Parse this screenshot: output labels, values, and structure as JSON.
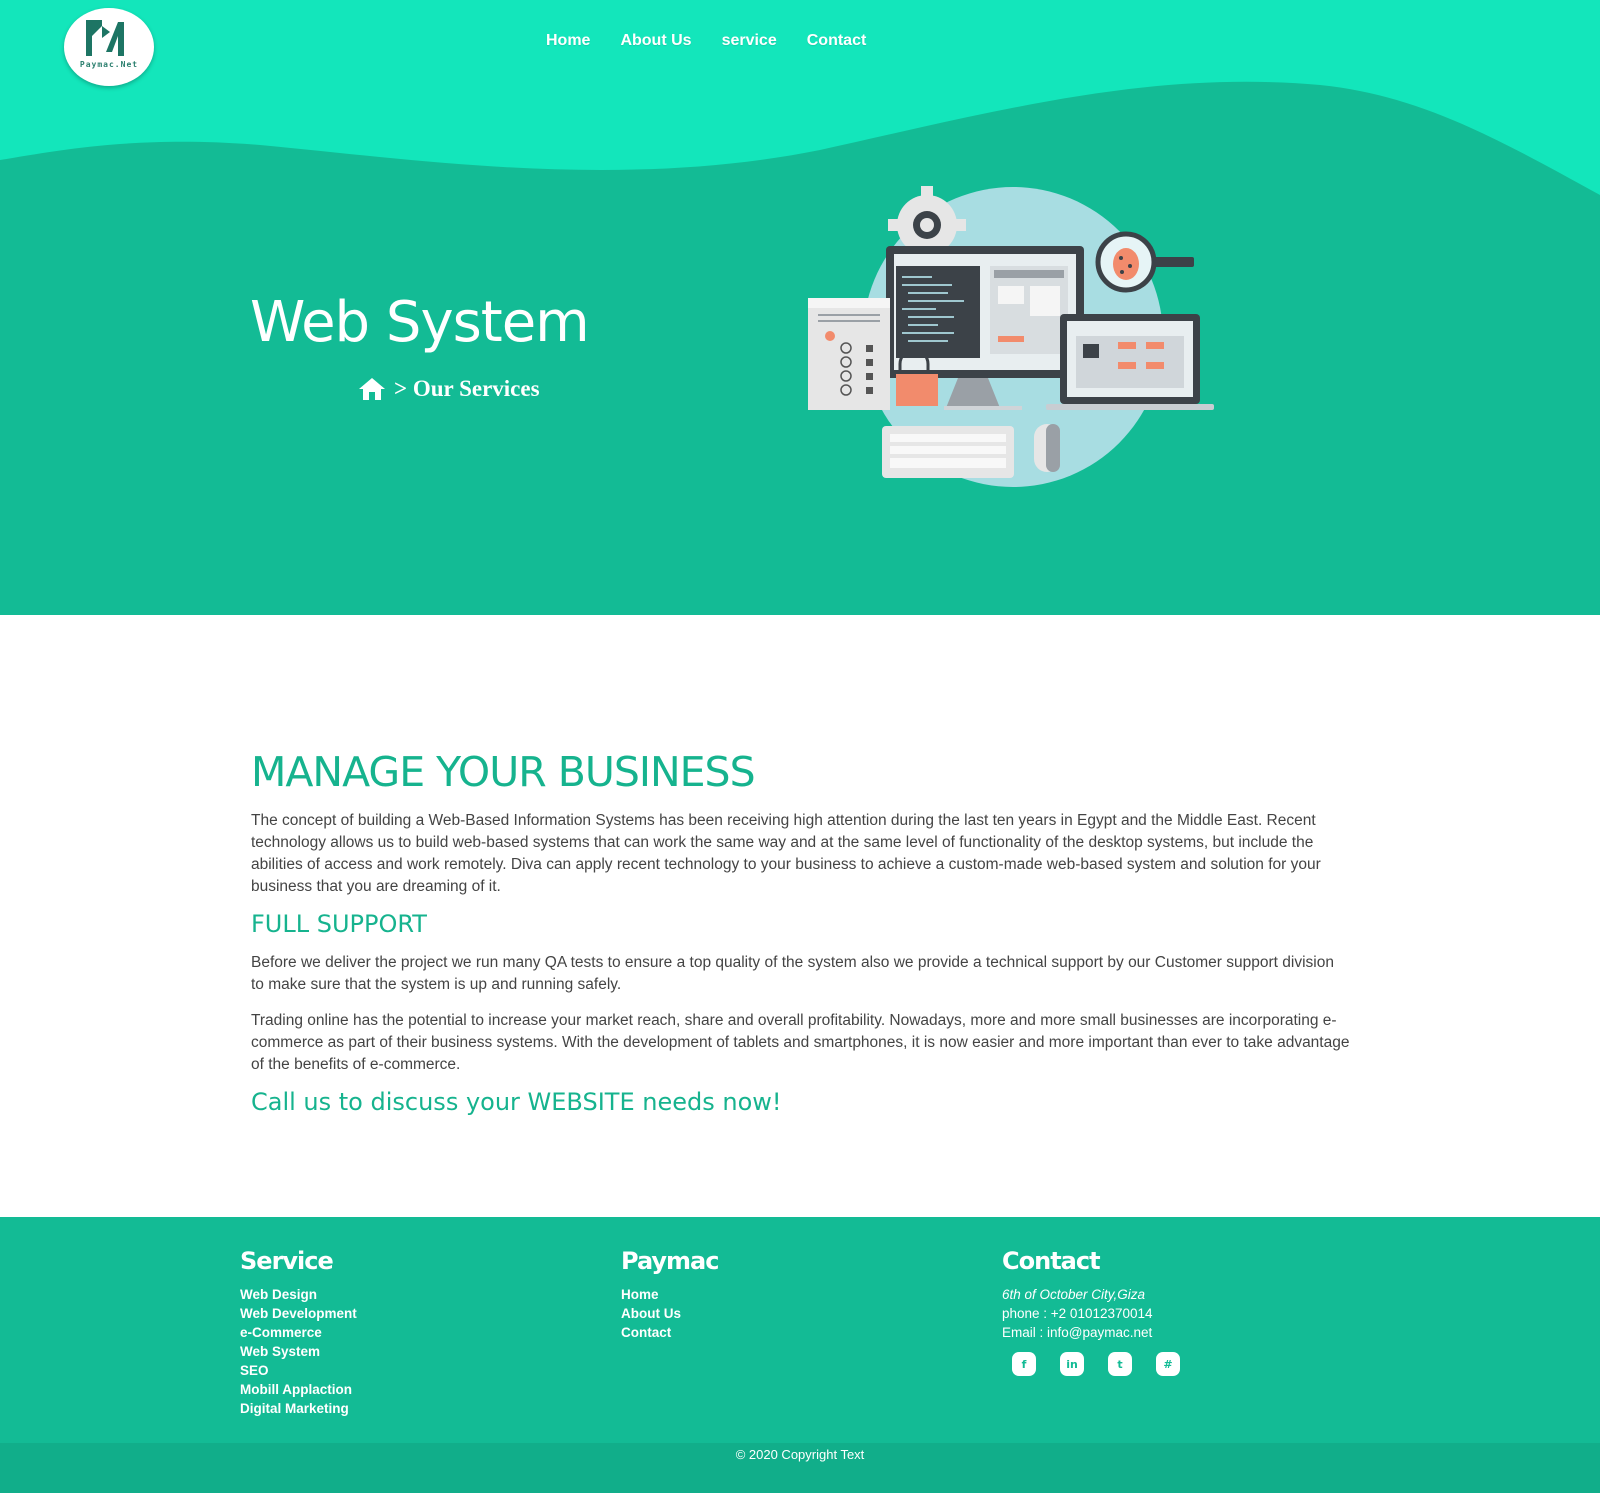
{
  "brand": {
    "logo_text": "Paymac.Net"
  },
  "nav": {
    "items": [
      "Home",
      "About Us",
      "service",
      "Contact"
    ]
  },
  "hero": {
    "title": "Web System",
    "breadcrumb_label": "> Our Services"
  },
  "main": {
    "heading": "MANAGE YOUR BUSINESS",
    "intro": "The concept of building a Web-Based Information Systems has been receiving high attention during the last ten years in Egypt and the Middle East. Recent technology allows us to build web-based systems that can work the same way and at the same level of functionality of the desktop systems, but include the abilities of access and work remotely. Diva can apply recent technology to your business to achieve a custom-made web-based system and solution for your business that you are dreaming of it.",
    "support_heading": "FULL SUPPORT",
    "support_text": "Before we deliver the project we run many QA tests to ensure a top quality of the system also we provide a technical support by our Customer support division to make sure that the system is up and running safely.",
    "trading_text": "Trading online has the potential to increase your market reach, share and overall profitability. Nowadays, more and more small businesses are incorporating e-commerce as part of their business systems. With the development of tablets and smartphones, it is now easier and more important than ever to take advantage of the benefits of e-commerce.",
    "cta": "Call us to discuss your WEBSITE needs now!"
  },
  "footer": {
    "service": {
      "title": "Service",
      "links": [
        "Web Design",
        "Web Development",
        "e-Commerce",
        "Web System",
        "SEO",
        "Mobill Applaction",
        "Digital Marketing"
      ]
    },
    "paymac": {
      "title": "Paymac",
      "links": [
        "Home",
        "About Us",
        "Contact"
      ]
    },
    "contact": {
      "title": "Contact",
      "address": "6th of October City,Giza",
      "phone": "phone : +2 01012370014",
      "email": "Email : info@paymac.net",
      "socials": [
        {
          "icon": "facebook-icon",
          "glyph": "f"
        },
        {
          "icon": "linkedin-icon",
          "glyph": "in"
        },
        {
          "icon": "twitter-icon",
          "glyph": "t"
        },
        {
          "icon": "slack-icon",
          "glyph": "#"
        }
      ]
    },
    "copyright": "© 2020 Copyright Text"
  },
  "colors": {
    "primary": "#13bb95",
    "hero_top": "#13e6bb",
    "accent_text": "#16b38e"
  }
}
